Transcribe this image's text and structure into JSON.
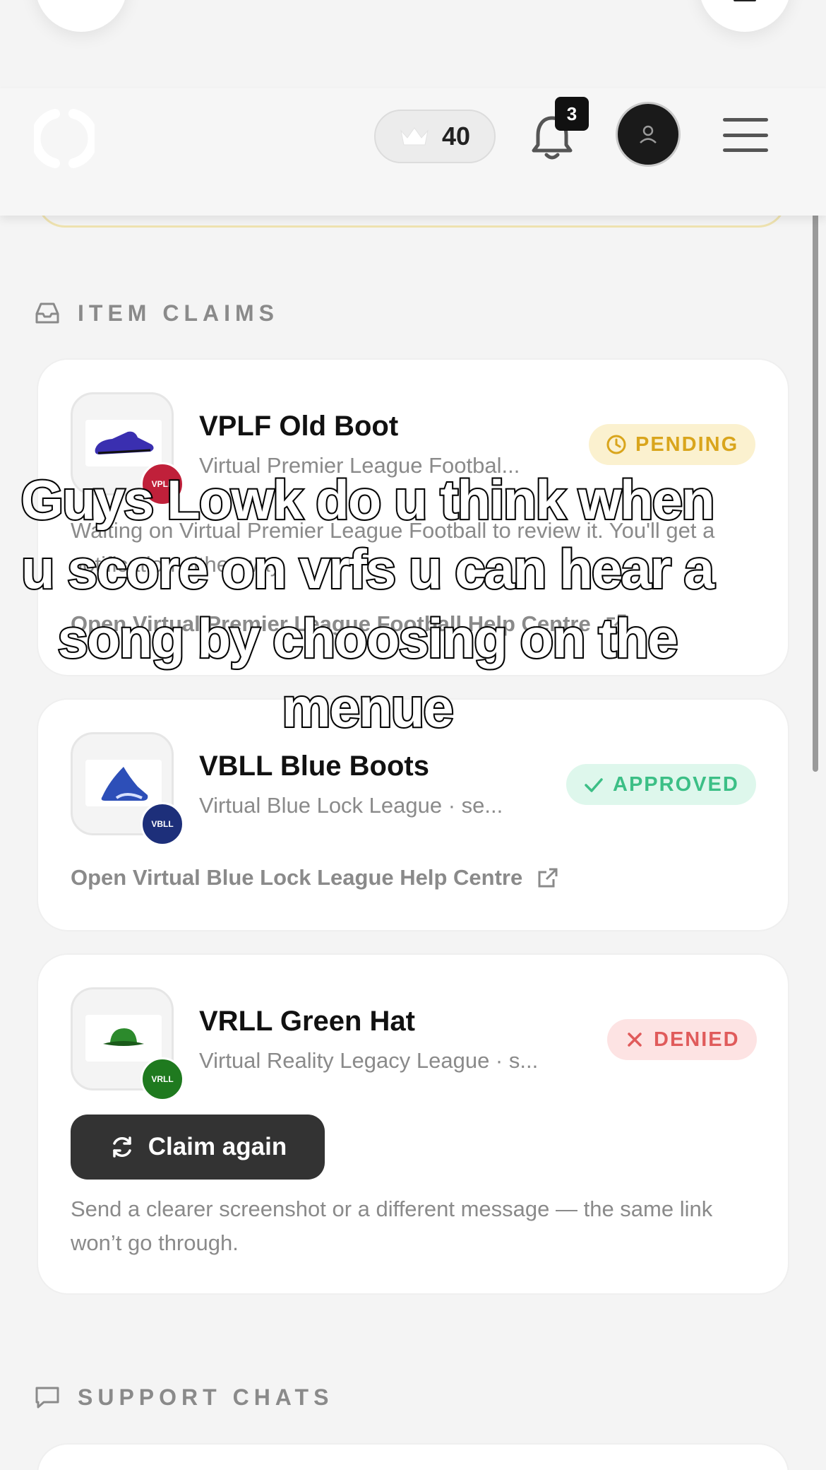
{
  "header": {
    "crown_count": "40",
    "notification_count": "3"
  },
  "item_claims": {
    "heading": "ITEM CLAIMS",
    "cards": [
      {
        "name": "VPLF Old Boot",
        "subtitle": "Virtual Premier League Footbal...",
        "status": "PENDING",
        "note": "Waiting on Virtual Premier League Football to review it. You'll get a notification either way.",
        "help_link": "Open Virtual Premier League Football Help Centre",
        "badge_text": "VPLF",
        "badge_color": "#c0203a"
      },
      {
        "name": "VBLL Blue Boots",
        "subtitle": "Virtual Blue Lock League · se...",
        "status": "APPROVED",
        "help_link": "Open Virtual Blue Lock League Help Centre",
        "badge_text": "VBLL",
        "badge_color": "#1d2f7a"
      },
      {
        "name": "VRLL Green Hat",
        "subtitle": "Virtual Reality Legacy League · s...",
        "status": "DENIED",
        "claim_again_label": "Claim again",
        "note": "Send a clearer screenshot or a different message — the same link won’t go through.",
        "badge_text": "VRLL",
        "badge_color": "#1f7a1f"
      }
    ]
  },
  "support_chats": {
    "heading": "SUPPORT CHATS"
  },
  "caption": "Guys Lowk do u think when u score on vrfs u can hear a song by choosing on the menue",
  "colors": {
    "pending": "#d9a51c",
    "approved": "#3cbf86",
    "denied": "#e05b5b"
  }
}
